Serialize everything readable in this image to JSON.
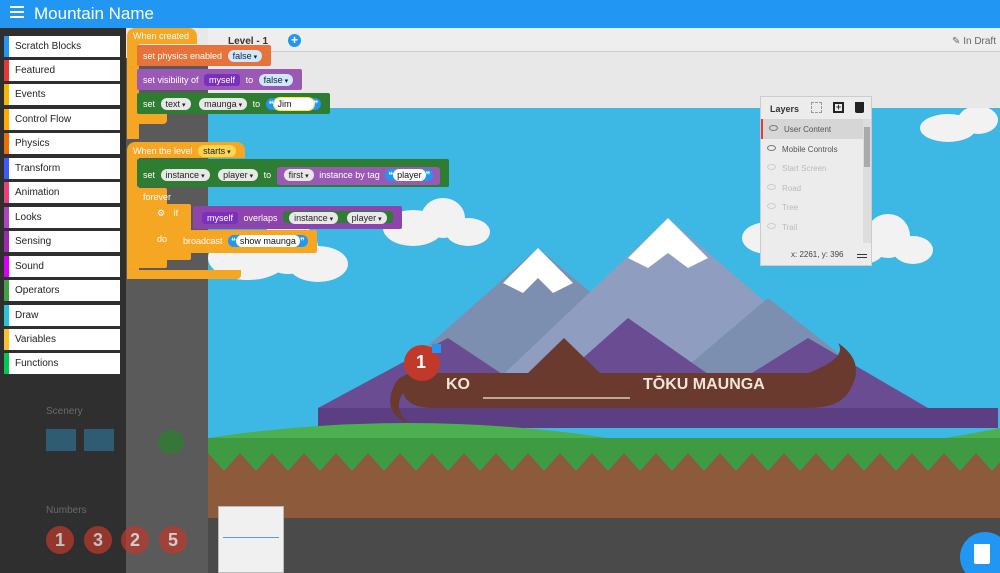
{
  "app": {
    "title": "Mountain Name"
  },
  "categories": [
    {
      "label": "Scratch Blocks",
      "color": "#2196f3"
    },
    {
      "label": "Featured",
      "color": "#e53935"
    },
    {
      "label": "Events",
      "color": "#f5b800"
    },
    {
      "label": "Control Flow",
      "color": "#ffab00"
    },
    {
      "label": "Physics",
      "color": "#ef6c00"
    },
    {
      "label": "Transform",
      "color": "#3d5afe"
    },
    {
      "label": "Animation",
      "color": "#ec407a"
    },
    {
      "label": "Looks",
      "color": "#ab47bc"
    },
    {
      "label": "Sensing",
      "color": "#9c27b0"
    },
    {
      "label": "Sound",
      "color": "#d500f9"
    },
    {
      "label": "Operators",
      "color": "#43a047"
    },
    {
      "label": "Draw",
      "color": "#26c6da"
    },
    {
      "label": "Variables",
      "color": "#fbc02d"
    },
    {
      "label": "Functions",
      "color": "#00c853"
    }
  ],
  "palette_side": {
    "scenery_label": "Scenery",
    "numbers_label": "Numbers",
    "numbers": [
      "1",
      "3",
      "2",
      "5"
    ]
  },
  "level_bar": {
    "level_label": "Level - 1",
    "add_symbol": "+",
    "status": "In Draft"
  },
  "layers": {
    "title": "Layers",
    "items": [
      "User Content",
      "Mobile Controls",
      "Start Screen",
      "Road",
      "Tree",
      "Trail"
    ],
    "coords": "x: 2261, y: 396"
  },
  "stage": {
    "badge_number": "1",
    "banner_left": "KO",
    "banner_right": "TŌKU MAUNGA"
  },
  "blocks": {
    "when_created": "When created",
    "set_physics": "set physics enabled",
    "physics_value": "false",
    "set_visibility": "set visibility of",
    "myself": "myself",
    "to": "to",
    "visibility_value": "false",
    "set": "set",
    "text_prop": "text",
    "maunga_var": "maunga",
    "jim_value": "Jim",
    "when_level": "When the level",
    "starts": "starts",
    "instance_var": "instance",
    "player_var": "player",
    "first": "first",
    "instance_by_tag": "instance by tag",
    "player_tag": "player",
    "forever": "forever",
    "if": "if",
    "overlaps": "overlaps",
    "do": "do",
    "broadcast": "broadcast",
    "broadcast_msg": "show maunga",
    "quote_open": "❝",
    "quote_close": "❞",
    "dropdown_arrow": "▾"
  },
  "colors": {
    "topbar": "#2196f3",
    "events": "#f5a623",
    "physics": "#e67e22",
    "looks": "#9b59b6",
    "variables": "#2e7d32",
    "control": "#f5a623",
    "sensing": "#8e44ad",
    "sky": "#3db7e4"
  }
}
